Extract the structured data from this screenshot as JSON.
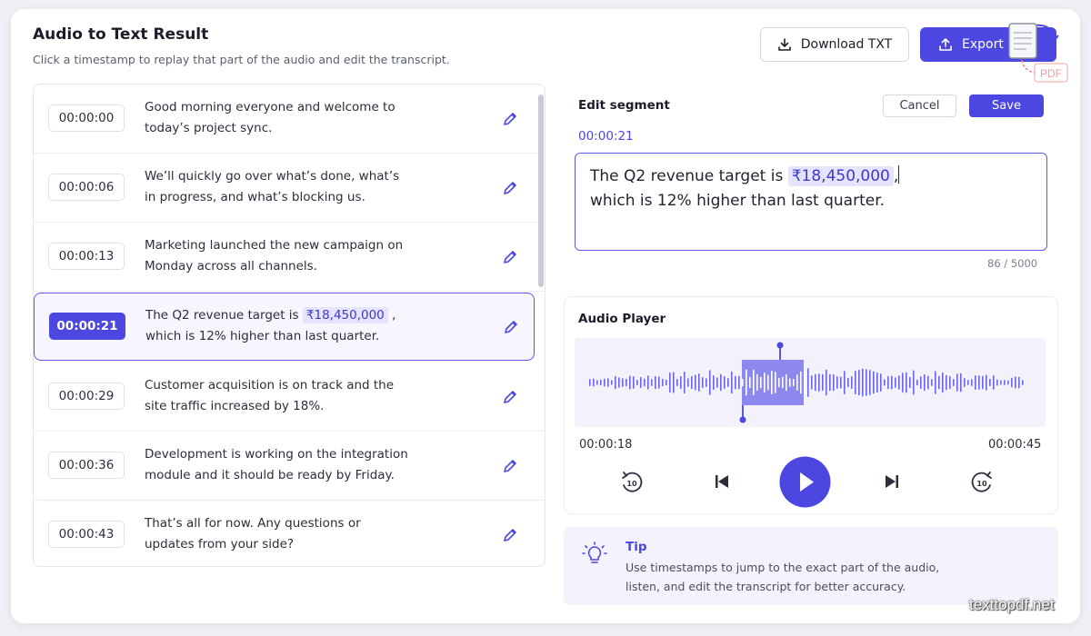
{
  "header": {
    "title": "Audio to Text Result",
    "subtitle": "Click a timestamp to replay that part of the audio and edit the transcript.",
    "download_label": "Download TXT",
    "export_label": "Export",
    "pdf_badge": "PDF"
  },
  "segments": [
    {
      "time": "00:00:00",
      "line1": "Good morning everyone and welcome to",
      "line2": "today’s project sync."
    },
    {
      "time": "00:00:06",
      "line1": "We’ll quickly go over what’s done, what’s",
      "line2": "in progress, and what’s blocking us."
    },
    {
      "time": "00:00:13",
      "line1": "Marketing launched the new campaign on",
      "line2": "Monday across all channels."
    },
    {
      "time": "00:00:21",
      "line1_pre": "The Q2 revenue target is ",
      "line1_hl": "₹18,450,000",
      "line1_post": " ,",
      "line2": "which is 12% higher than last quarter.",
      "active": true
    },
    {
      "time": "00:00:29",
      "line1": "Customer acquisition is on track and the",
      "line2": "site traffic increased by 18%."
    },
    {
      "time": "00:00:36",
      "line1": "Development is working on the integration",
      "line2": "module and it should be ready by Friday."
    },
    {
      "time": "00:00:43",
      "line1": "That’s all for now. Any questions or",
      "line2": "updates from your side?"
    }
  ],
  "edit": {
    "title": "Edit segment",
    "cancel_label": "Cancel",
    "save_label": "Save",
    "timestamp": "00:00:21",
    "text_pre": "The Q2 revenue target is ",
    "text_hl": "₹18,450,000",
    "text_post": ",",
    "text_line2": "which is 12% higher than last quarter.",
    "counter": "86 / 5000"
  },
  "player": {
    "title": "Audio Player",
    "start_time": "00:00:18",
    "end_time": "00:00:45",
    "rewind_label": "10",
    "forward_label": "10"
  },
  "tip": {
    "title": "Tip",
    "text": "Use timestamps to jump to the exact part of the audio, listen, and edit the transcript for better accuracy."
  },
  "watermark": "texttopdf.net",
  "colors": {
    "accent": "#4b47e0",
    "highlight_bg": "#e5e3fd",
    "tip_bg": "#f3f2fd"
  }
}
